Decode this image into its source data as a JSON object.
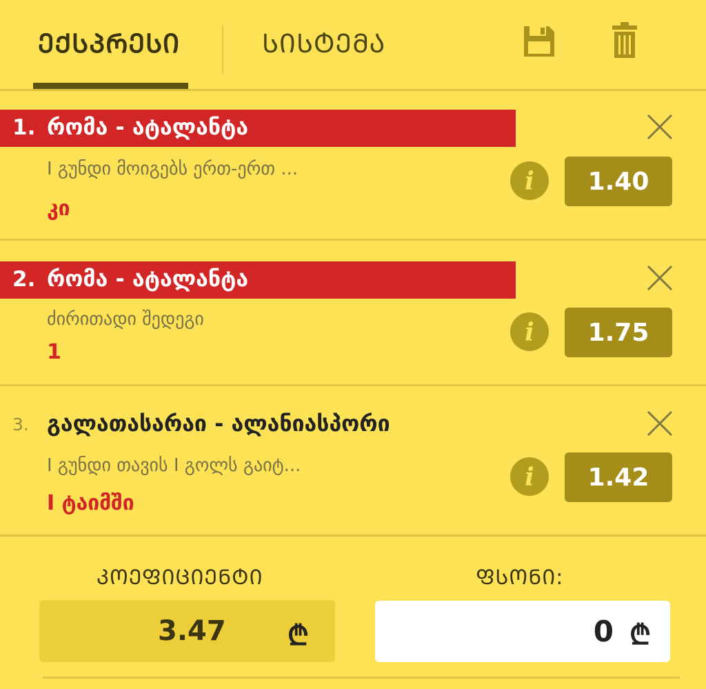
{
  "tabs": {
    "express": "ᲔᲥᲡᲞᲠᲔᲡᲘ",
    "system": "ᲡᲘᲡᲢᲔᲛᲐ"
  },
  "colors": {
    "background": "#fde255",
    "accent_red": "#d22525",
    "odds_bg": "#a48d18",
    "icon_olive": "#a9921b"
  },
  "bets": [
    {
      "num": "1.",
      "match": "რომა - ატალანტა",
      "market": "I გუნდი მოიგებს ერთ-ერთ ...",
      "selection": "კი",
      "odds": "1.40"
    },
    {
      "num": "2.",
      "match": "რომა - ატალანტა",
      "market": "ძირითადი შედეგი",
      "selection": "1",
      "odds": "1.75"
    },
    {
      "num": "3.",
      "match": "გალათასარაი - ალანიასპორი",
      "market": "I გუნდი თავის I გოლს გაიტ...",
      "selection": "I ტაიმში",
      "odds": "1.42"
    }
  ],
  "footer": {
    "coef_label": "ᲙᲝᲔᲤᲘᲪᲘᲔᲜᲢᲘ",
    "coef_value": "3.47",
    "stake_label": "ᲤᲡᲝᲜᲘ:",
    "stake_value": "0",
    "currency": "₾"
  },
  "icons": [
    "save-icon",
    "trash-icon",
    "close-icon",
    "info-icon"
  ]
}
